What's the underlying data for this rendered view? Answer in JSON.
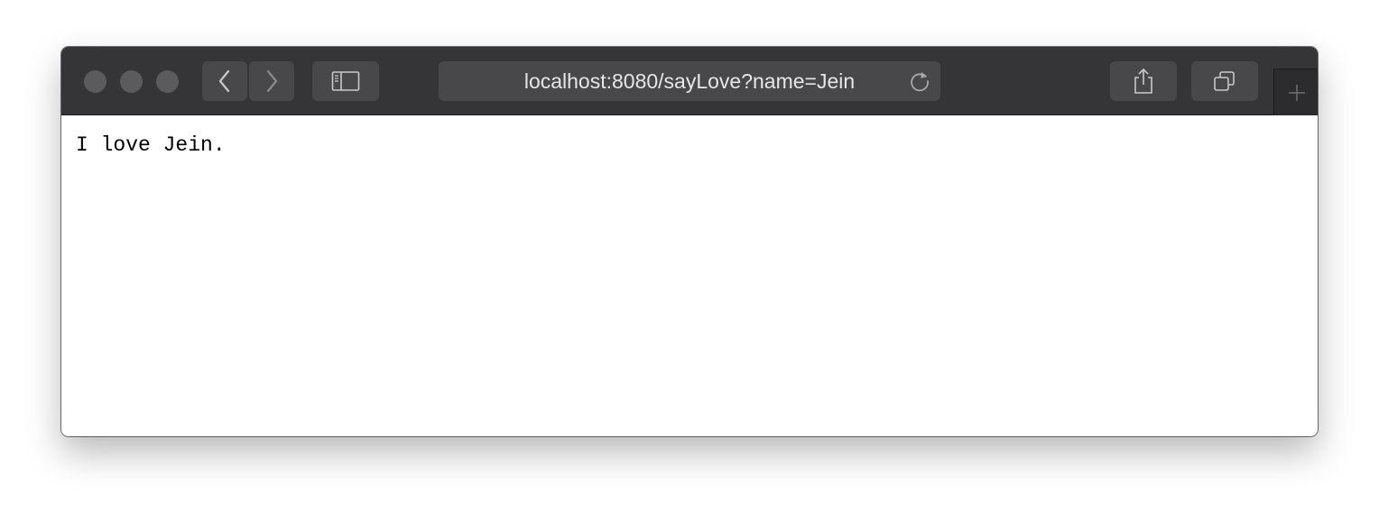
{
  "browser": {
    "address_bar": {
      "url": "localhost:8080/sayLove?name=Jein"
    },
    "toolbar_icons": {
      "back": "chevron-left-icon",
      "forward": "chevron-right-icon",
      "sidebar": "sidebar-icon",
      "reload": "reload-icon",
      "share": "share-icon",
      "tabs": "tab-overview-icon",
      "new_tab": "plus-icon"
    },
    "colors": {
      "toolbar": "#353537",
      "button": "#48484b",
      "url_text": "#e6e6e6"
    }
  },
  "page": {
    "body_text": "I love Jein."
  }
}
